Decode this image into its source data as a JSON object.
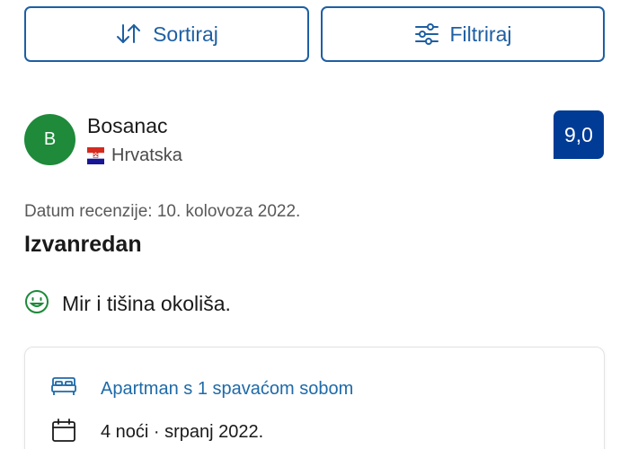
{
  "toolbar": {
    "sort_label": "Sortiraj",
    "filter_label": "Filtriraj"
  },
  "review": {
    "avatar_letter": "B",
    "reviewer_name": "Bosanac",
    "country": "Hrvatska",
    "score": "9,0",
    "date_text": "Datum recenzije: 10. kolovoza 2022.",
    "title": "Izvanredan",
    "positive_text": "Mir i tišina okoliša."
  },
  "stay": {
    "room_type": "Apartman s 1 spavaćom sobom",
    "nights_text": "4 noći · srpanj 2022."
  },
  "colors": {
    "accent_blue": "#1e5fa3",
    "score_bg": "#003b95",
    "avatar_bg": "#1e8a3a",
    "positive_icon": "#1e8a3a"
  },
  "icons": {
    "sort": "sort-arrows-icon",
    "filter": "filter-sliders-icon",
    "flag": "croatia-flag-icon",
    "positive": "smiley-face-icon",
    "room": "bed-icon",
    "nights": "calendar-icon"
  }
}
